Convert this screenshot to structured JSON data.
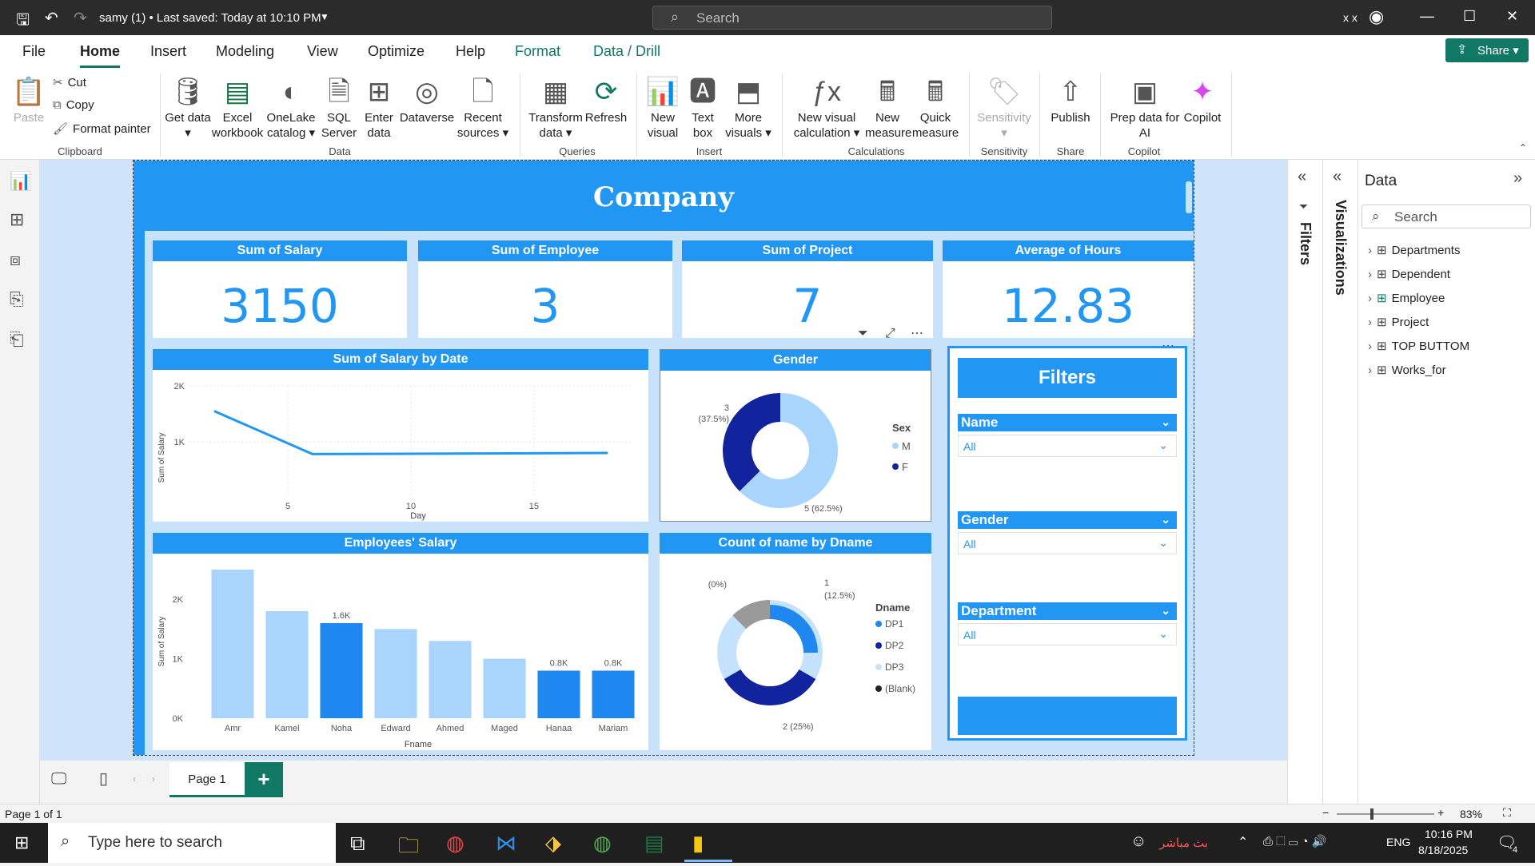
{
  "titlebar": {
    "doc_title": "samy (1) • Last saved: Today at 10:10 PM",
    "search_placeholder": "Search",
    "user": "x x"
  },
  "menu": {
    "tabs": [
      "File",
      "Home",
      "Insert",
      "Modeling",
      "View",
      "Optimize",
      "Help",
      "Format",
      "Data / Drill"
    ],
    "share": "Share"
  },
  "ribbon": {
    "clipboard": {
      "paste": "Paste",
      "cut": "Cut",
      "copy": "Copy",
      "format_painter": "Format painter",
      "group": "Clipboard"
    },
    "data": {
      "get_data": "Get data",
      "excel": "Excel workbook",
      "onelake": "OneLake catalog",
      "sql": "SQL Server",
      "enter": "Enter data",
      "dataverse": "Dataverse",
      "recent": "Recent sources",
      "group": "Data"
    },
    "queries": {
      "transform": "Transform data",
      "refresh": "Refresh",
      "group": "Queries"
    },
    "insert": {
      "new_visual": "New visual",
      "text_box": "Text box",
      "more_visuals": "More visuals",
      "group": "Insert"
    },
    "calculations": {
      "new_visual_calc": "New visual calculation",
      "new_measure": "New measure",
      "quick_measure": "Quick measure",
      "group": "Calculations"
    },
    "sensitivity": {
      "label": "Sensitivity",
      "group": "Sensitivity"
    },
    "share": {
      "publish": "Publish",
      "group": "Share"
    },
    "copilot": {
      "prep": "Prep data for AI",
      "copilot": "Copilot",
      "group": "Copilot"
    }
  },
  "report": {
    "title": "Company",
    "kpis": [
      {
        "label": "Sum of Salary",
        "value": "3150"
      },
      {
        "label": "Sum of Employee",
        "value": "3"
      },
      {
        "label": "Sum of Project",
        "value": "7"
      },
      {
        "label": "Average of Hours",
        "value": "12.83"
      }
    ]
  },
  "chart_data": [
    {
      "type": "line",
      "title": "Sum of Salary by Date",
      "xlabel": "Day",
      "ylabel": "Sum of Salary",
      "x": [
        2,
        6,
        18
      ],
      "y": [
        1550,
        780,
        800
      ],
      "xticks": [
        "5",
        "10",
        "15"
      ],
      "xtick_values": [
        5,
        10,
        15
      ],
      "yticks": [
        "1K",
        "2K"
      ],
      "ytick_values": [
        1000,
        2000
      ],
      "xlim": [
        1,
        19
      ],
      "ylim": [
        0,
        2000
      ],
      "color": "#2196f3"
    },
    {
      "type": "pie",
      "title": "Gender",
      "legend_title": "Sex",
      "slices": [
        {
          "name": "M",
          "value": 5,
          "label": "5 (62.5%)",
          "color": "#a9d4fb"
        },
        {
          "name": "F",
          "value": 3,
          "label": "3 (37.5%)",
          "color": "#12239e"
        }
      ]
    },
    {
      "type": "bar",
      "title": "Employees' Salary",
      "xlabel": "Fname",
      "ylabel": "Sum of Salary",
      "categories": [
        "Amr",
        "Kamel",
        "Noha",
        "Edward",
        "Ahmed",
        "Maged",
        "Hanaa",
        "Mariam"
      ],
      "values": [
        2500,
        1800,
        1600,
        1500,
        1300,
        1000,
        800,
        800
      ],
      "data_labels": [
        "",
        "",
        "1.6K",
        "",
        "",
        "",
        "0.8K",
        "0.8K"
      ],
      "highlight": [
        false,
        false,
        true,
        false,
        false,
        false,
        true,
        true
      ],
      "colors": {
        "normal": "#a9d4fb",
        "highlight": "#1e88f0"
      },
      "yticks": [
        "0K",
        "1K",
        "2K"
      ],
      "ytick_values": [
        0,
        1000,
        2000
      ],
      "ylim": [
        0,
        2500
      ]
    },
    {
      "type": "pie",
      "title": "Count of name by Dname",
      "legend_title": "Dname",
      "slices": [
        {
          "name": "DP1",
          "value": 1,
          "label": "1 (12.5%)",
          "color": "#1e88f0"
        },
        {
          "name": "DP2",
          "value": 2,
          "label": "2 (25%)",
          "color": "#12239e"
        },
        {
          "name": "DP3",
          "value": 5,
          "label": "",
          "color": "#c5e2fc"
        },
        {
          "name": "(Blank)",
          "value": 0,
          "label": "(0%)",
          "color": "#999999"
        }
      ]
    }
  ],
  "filters": {
    "title": "Filters",
    "slicers": [
      {
        "label": "Name",
        "value": "All"
      },
      {
        "label": "Gender",
        "value": "All"
      },
      {
        "label": "Department",
        "value": "All"
      }
    ]
  },
  "panes": {
    "filters_label": "Filters",
    "visualizations_label": "Visualizations",
    "data_title": "Data",
    "data_search": "Search",
    "tables": [
      "Departments",
      "Dependent",
      "Employee",
      "Project",
      "TOP BUTTOM",
      "Works_for"
    ]
  },
  "pages": {
    "tab": "Page 1",
    "status": "Page 1 of 1",
    "zoom": "83%"
  },
  "taskbar": {
    "search": "Type here to search",
    "live": "بث مباشر",
    "lang": "ENG",
    "time": "10:16 PM",
    "date": "8/18/2025",
    "notif": "4"
  }
}
